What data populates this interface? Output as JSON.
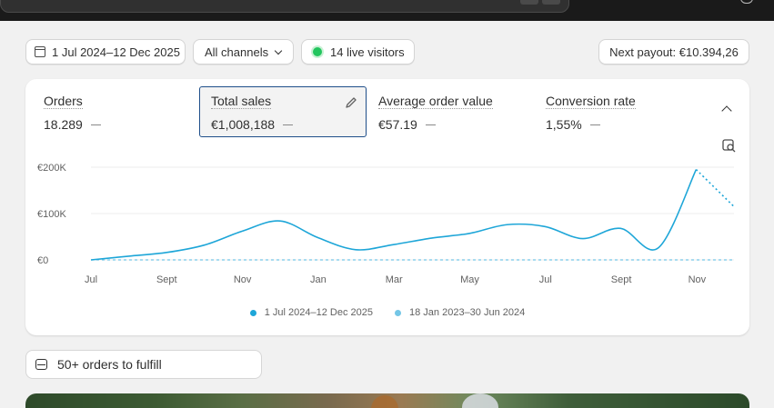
{
  "filters": {
    "date_range": "1 Jul 2024–12 Dec 2025",
    "channels": "All channels",
    "live_visitors": "14 live visitors",
    "payout": "Next payout: €10.394,26"
  },
  "metrics": [
    {
      "label": "Orders",
      "value": "18.289"
    },
    {
      "label": "Total sales",
      "value": "€1,008,188"
    },
    {
      "label": "Average order value",
      "value": "€57.19"
    },
    {
      "label": "Conversion rate",
      "value": "1,55%"
    }
  ],
  "colors": {
    "current_series": "#1ea6d8",
    "previous_series": "#74c6e6",
    "live_dot": "#22c55e",
    "selected_border": "#1f4f8a"
  },
  "icons": {
    "date": "calendar-icon",
    "channels": "chevron-down-icon",
    "edit": "pencil-icon",
    "collapse": "chevron-up-icon",
    "chart_view": "chart-search-icon",
    "orders": "inbox-icon"
  },
  "chart_data": {
    "type": "line",
    "title": "",
    "xlabel": "",
    "ylabel": "",
    "y_ticks": [
      "€0",
      "€100K",
      "€200K"
    ],
    "ylim": [
      0,
      200000
    ],
    "x_ticks": [
      "Jul",
      "Sept",
      "Nov",
      "Jan",
      "Mar",
      "May",
      "Jul",
      "Sept",
      "Nov"
    ],
    "grid": "horizontal",
    "legend_position": "bottom",
    "series": [
      {
        "name": "1 Jul 2024–12 Dec 2025",
        "x": [
          "Jul",
          "Aug",
          "Sept",
          "Oct",
          "Nov",
          "Dec",
          "Jan",
          "Feb",
          "Mar",
          "Apr",
          "May",
          "Jun",
          "Jul",
          "Aug",
          "Sept",
          "Oct",
          "Nov",
          "Dec"
        ],
        "values": [
          0,
          8000,
          16000,
          32000,
          62000,
          84000,
          48000,
          22000,
          33000,
          47000,
          57000,
          76000,
          72000,
          46000,
          68000,
          26000,
          195000,
          115000
        ],
        "style": "solid, last segment dotted"
      },
      {
        "name": "18 Jan 2023–30 Jun 2024",
        "x": [
          "Jul",
          "Nov"
        ],
        "values": [
          0,
          0
        ],
        "style": "dashed"
      }
    ]
  },
  "fulfill": {
    "label": "50+ orders to fulfill"
  }
}
